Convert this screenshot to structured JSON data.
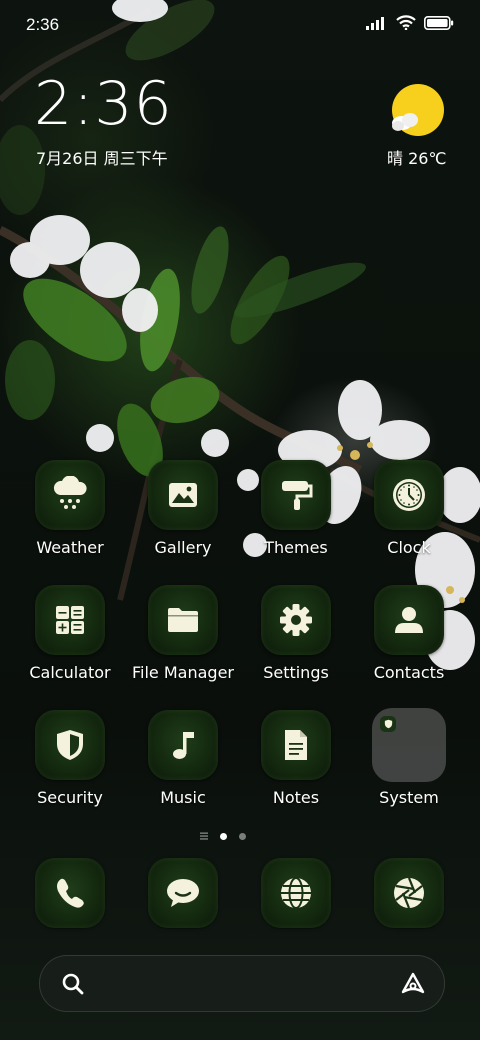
{
  "status_bar": {
    "time": "2:36"
  },
  "clock": {
    "time": "2:36",
    "date": "7月26日 周三下午"
  },
  "weather": {
    "condition": "晴",
    "temperature": "26℃"
  },
  "apps": [
    {
      "label": "Weather",
      "icon": "weather-snow-cloud-icon"
    },
    {
      "label": "Gallery",
      "icon": "gallery-picture-icon"
    },
    {
      "label": "Themes",
      "icon": "paint-roller-icon"
    },
    {
      "label": "Clock",
      "icon": "clock-icon"
    },
    {
      "label": "Calculator",
      "icon": "calculator-icon"
    },
    {
      "label": "File Manager",
      "icon": "folder-icon"
    },
    {
      "label": "Settings",
      "icon": "gear-icon"
    },
    {
      "label": "Contacts",
      "icon": "person-icon"
    },
    {
      "label": "Security",
      "icon": "shield-icon"
    },
    {
      "label": "Music",
      "icon": "music-note-icon"
    },
    {
      "label": "Notes",
      "icon": "document-icon"
    },
    {
      "label": "System",
      "icon": "folder-group-icon"
    }
  ],
  "dock": [
    {
      "icon": "phone-icon"
    },
    {
      "icon": "chat-bubble-icon"
    },
    {
      "icon": "globe-icon"
    },
    {
      "icon": "camera-aperture-icon"
    }
  ],
  "page_indicator": {
    "pages": 2,
    "active": 1
  },
  "colors": {
    "icon_glyph": "#f4f1dc",
    "icon_bg": "#1a3315",
    "sun": "#f7cf1d"
  }
}
